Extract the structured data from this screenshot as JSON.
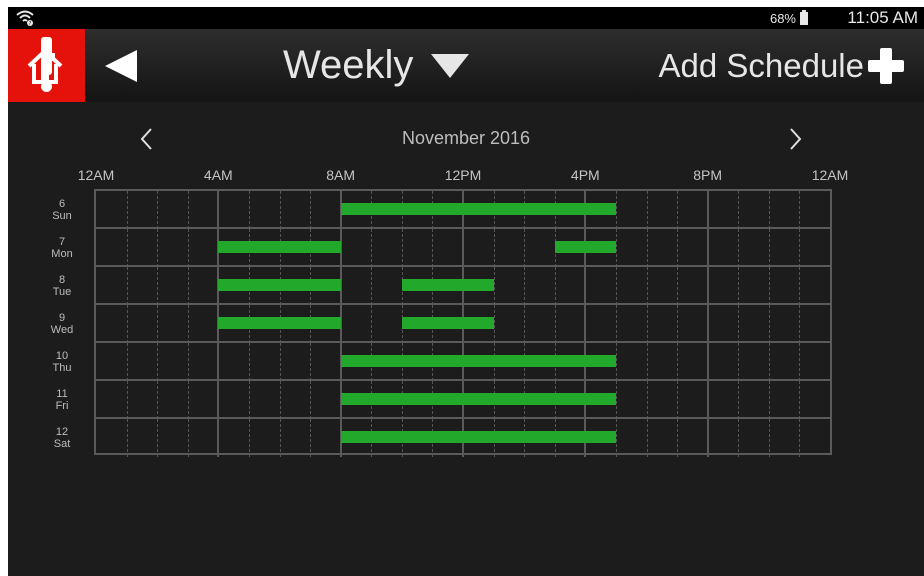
{
  "status_bar": {
    "battery": "68%",
    "time": "11:05 AM"
  },
  "toolbar": {
    "view_label": "Weekly",
    "add_label": "Add Schedule"
  },
  "calendar": {
    "month": "November 2016",
    "hours": [
      "12AM",
      "4AM",
      "8AM",
      "12PM",
      "4PM",
      "8PM",
      "12AM"
    ],
    "days": [
      {
        "date": "6",
        "weekday": "Sun",
        "blocks": [
          [
            8,
            17
          ]
        ]
      },
      {
        "date": "7",
        "weekday": "Mon",
        "blocks": [
          [
            4,
            8
          ],
          [
            15,
            17
          ]
        ]
      },
      {
        "date": "8",
        "weekday": "Tue",
        "blocks": [
          [
            4,
            8
          ],
          [
            10,
            13
          ]
        ]
      },
      {
        "date": "9",
        "weekday": "Wed",
        "blocks": [
          [
            4,
            8
          ],
          [
            10,
            13
          ]
        ]
      },
      {
        "date": "10",
        "weekday": "Thu",
        "blocks": [
          [
            8,
            17
          ]
        ]
      },
      {
        "date": "11",
        "weekday": "Fri",
        "blocks": [
          [
            8,
            17
          ]
        ]
      },
      {
        "date": "12",
        "weekday": "Sat",
        "blocks": [
          [
            8,
            17
          ]
        ]
      }
    ]
  },
  "colors": {
    "schedule_block": "#22a82a",
    "alert": "#e5120c",
    "background": "#1c1c1c"
  }
}
